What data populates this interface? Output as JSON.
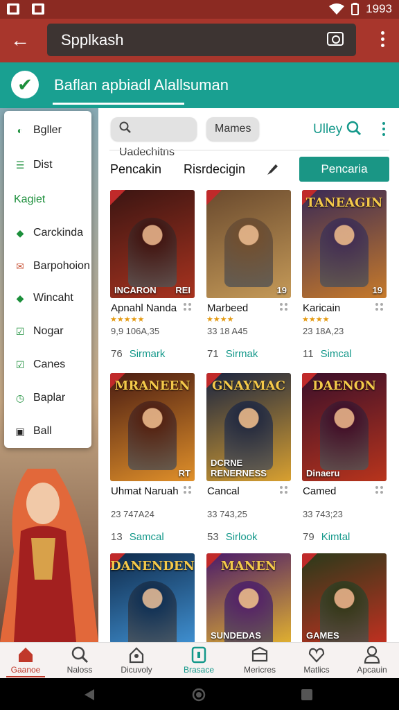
{
  "status_bar": {
    "time": "1993"
  },
  "app_bar": {
    "search_value": "Spplkash"
  },
  "banner": {
    "text": "Baflan apbiadl Alallsuman"
  },
  "drawer": {
    "items": [
      {
        "label": "Bgller",
        "icon": "circle-leaf-icon",
        "color": "#1c8f3b"
      },
      {
        "label": "Dist",
        "icon": "list-icon",
        "color": "#1c8f3b"
      },
      {
        "label": "Kagiet",
        "icon": "",
        "color": "#1c8f3b"
      },
      {
        "label": "Carckinda",
        "icon": "tag-icon",
        "color": "#1c8f3b"
      },
      {
        "label": "Barpohoion",
        "icon": "mail-icon",
        "color": "#c8553a"
      },
      {
        "label": "Wincaht",
        "icon": "tag-icon",
        "color": "#1c8f3b"
      },
      {
        "label": "Nogar",
        "icon": "check-box-icon",
        "color": "#1c8f3b"
      },
      {
        "label": "Canes",
        "icon": "check-box-icon",
        "color": "#1c8f3b"
      },
      {
        "label": "Baplar",
        "icon": "clock-icon",
        "color": "#1c8f3b"
      },
      {
        "label": "Ball",
        "icon": "monitor-icon",
        "color": "#222222"
      }
    ]
  },
  "filters": {
    "chip1": "Uadechitns",
    "chip2": "Mames",
    "link": "Ulley"
  },
  "tabs": {
    "tab1": "Pencakin",
    "tab2": "Risrdecigin",
    "primary_button": "Pencaria"
  },
  "games": [
    {
      "title": "Apnahl Nanda",
      "art_title": "",
      "art_bottom": "INCARON",
      "art_badge": "REI",
      "stars": "★★★★★",
      "num": "9,9 106A,35",
      "count": "76",
      "label": "Sirmark",
      "c1": "#3b1512",
      "c2": "#a8331f"
    },
    {
      "title": "Marbeed",
      "art_title": "",
      "art_bottom": "",
      "art_badge": "19",
      "stars": "★★★★",
      "num": "33 18 A45",
      "count": "71",
      "label": "Sirmak",
      "c1": "#6a4a2e",
      "c2": "#c59a58"
    },
    {
      "title": "Karicain",
      "art_title": "TANEAGIN",
      "art_bottom": "",
      "art_badge": "19",
      "stars": "★★★★",
      "num": "23 18A,23",
      "count": "11",
      "label": "Simcal",
      "c1": "#3a2a55",
      "c2": "#c77a2a"
    },
    {
      "title": "Uhmat Naruah",
      "art_title": "MRANEEN",
      "art_bottom": "",
      "art_badge": "RT",
      "stars": "",
      "num": "23 747A24",
      "count": "13",
      "label": "Samcal",
      "c1": "#4a1c12",
      "c2": "#e0902a"
    },
    {
      "title": "Cancal",
      "art_title": "GNAYMAC",
      "art_bottom": "DCRNE RENERNESS",
      "art_badge": "",
      "stars": "",
      "num": "33 743,25",
      "count": "53",
      "label": "Sirlook",
      "c1": "#1a2440",
      "c2": "#d8a030"
    },
    {
      "title": "Camed",
      "art_title": "DAENON",
      "art_bottom": "Dinaeru",
      "art_badge": "",
      "stars": "",
      "num": "33 743;23",
      "count": "79",
      "label": "Kimtal",
      "c1": "#3a0f2a",
      "c2": "#b8341c"
    },
    {
      "title": "",
      "art_title": "DANENDEN",
      "art_bottom": "",
      "art_badge": "",
      "stars": "",
      "num": "",
      "count": "",
      "label": "",
      "c1": "#0f2a4a",
      "c2": "#3f8fd0"
    },
    {
      "title": "",
      "art_title": "MANEN",
      "art_bottom": "SUNDEDAS",
      "art_badge": "",
      "stars": "",
      "num": "",
      "count": "",
      "label": "",
      "c1": "#4a1a6a",
      "c2": "#e0b030"
    },
    {
      "title": "",
      "art_title": "",
      "art_bottom": "GAMES",
      "art_badge": "",
      "stars": "",
      "num": "",
      "count": "",
      "label": "",
      "c1": "#2a3a1a",
      "c2": "#c03020"
    }
  ],
  "bottom_nav": [
    {
      "label": "Gaanoe",
      "icon": "home-icon",
      "color": "#c0392b"
    },
    {
      "label": "Naloss",
      "icon": "search-icon",
      "color": "#444444"
    },
    {
      "label": "Dicuvoly",
      "icon": "house-outline-icon",
      "color": "#444444"
    },
    {
      "label": "Brasace",
      "icon": "box-icon",
      "color": "#14988a"
    },
    {
      "label": "Mericres",
      "icon": "ticket-icon",
      "color": "#444444"
    },
    {
      "label": "Matlics",
      "icon": "heart-icon",
      "color": "#444444"
    },
    {
      "label": "Apcauin",
      "icon": "person-icon",
      "color": "#444444"
    }
  ]
}
